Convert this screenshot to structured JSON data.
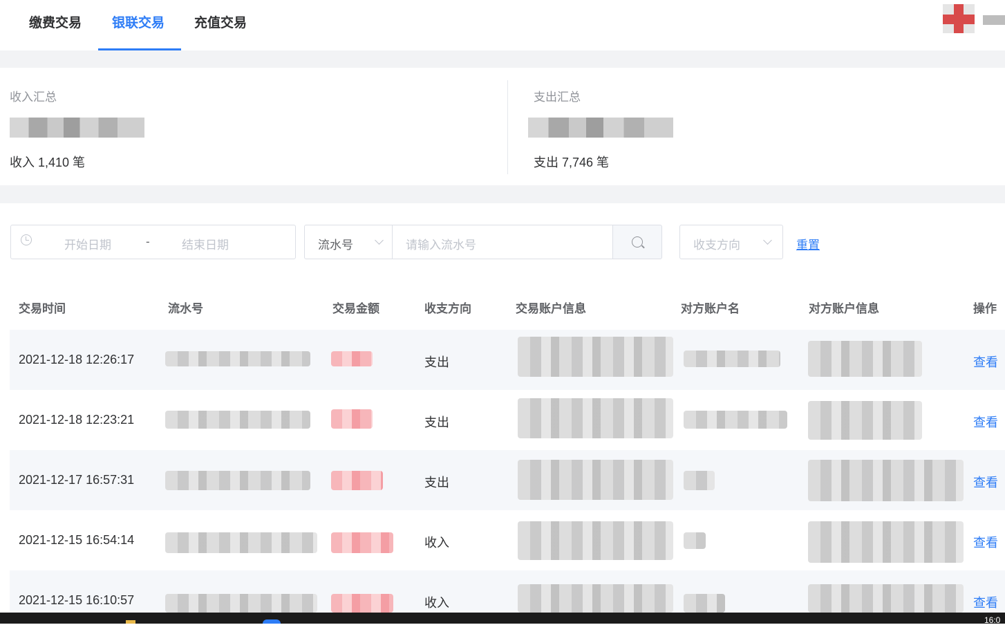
{
  "tabs": [
    {
      "label": "缴费交易",
      "active": false
    },
    {
      "label": "银联交易",
      "active": true
    },
    {
      "label": "充值交易",
      "active": false
    }
  ],
  "summary": {
    "income": {
      "title": "收入汇总",
      "count": "收入 1,410 笔"
    },
    "expense": {
      "title": "支出汇总",
      "count": "支出 7,746 笔"
    }
  },
  "filters": {
    "start_date_placeholder": "开始日期",
    "date_separator": "-",
    "end_date_placeholder": "结束日期",
    "search_type": "流水号",
    "search_placeholder": "请输入流水号",
    "direction_placeholder": "收支方向",
    "reset_label": "重置"
  },
  "table": {
    "columns": [
      "交易时间",
      "流水号",
      "交易金额",
      "收支方向",
      "交易账户信息",
      "对方账户名",
      "对方账户信息",
      "操作"
    ],
    "rows": [
      {
        "time": "2021-12-18 12:26:17",
        "direction": "支出",
        "action": "查看"
      },
      {
        "time": "2021-12-18 12:23:21",
        "direction": "支出",
        "action": "查看"
      },
      {
        "time": "2021-12-17 16:57:31",
        "direction": "支出",
        "action": "查看"
      },
      {
        "time": "2021-12-15 16:54:14",
        "direction": "收入",
        "action": "查看"
      },
      {
        "time": "2021-12-15 16:10:57",
        "direction": "收入",
        "action": "查看"
      }
    ]
  },
  "taskbar": {
    "clock": "16:0"
  },
  "colors": {
    "accent": "#2d7cf6",
    "amount": "#f49ea4",
    "page_bg": "#f2f3f5"
  }
}
